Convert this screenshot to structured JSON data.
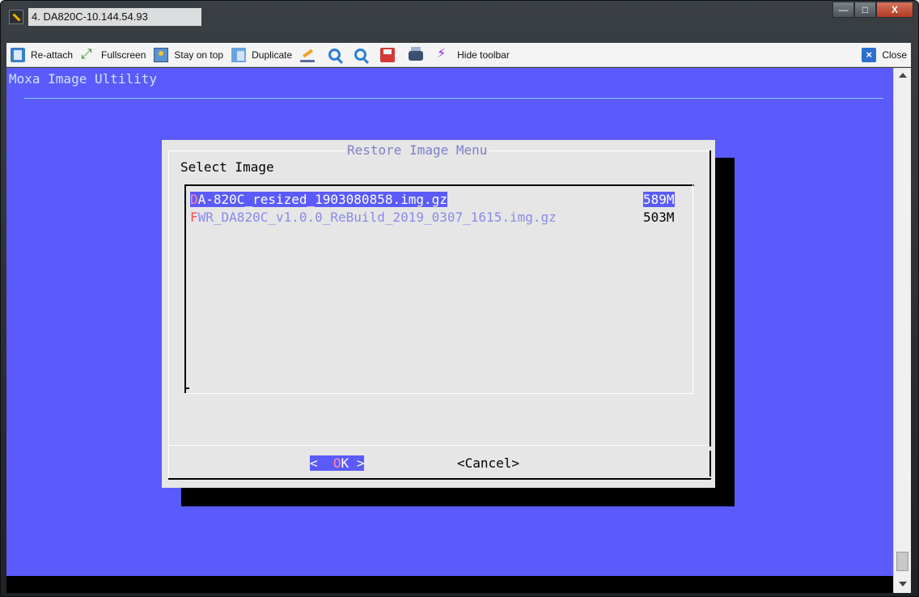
{
  "window": {
    "title": "4. DA820C-10.144.54.93"
  },
  "toolbar": {
    "reattach": "Re-attach",
    "fullscreen": "Fullscreen",
    "stay_on_top": "Stay on top",
    "duplicate": "Duplicate",
    "hide_toolbar": "Hide toolbar",
    "close": "Close"
  },
  "terminal": {
    "app_title": "Moxa Image Ultility",
    "background_color": "#5b5bfb"
  },
  "dialog": {
    "title": "Restore Image Menu",
    "prompt": "Select Image",
    "items": [
      {
        "hotkey": "D",
        "rest": "A-820C_resized_1903080858.img.gz",
        "size": "589M",
        "selected": true
      },
      {
        "hotkey": "F",
        "rest": "WR_DA820C_v1.0.0_ReBuild_2019_0307_1615.img.gz",
        "size": "503M",
        "selected": false
      }
    ],
    "ok_button": {
      "left": "< ",
      "hotkey": "O",
      "rest": "K",
      "right": " >"
    },
    "cancel_button": "<Cancel>"
  }
}
